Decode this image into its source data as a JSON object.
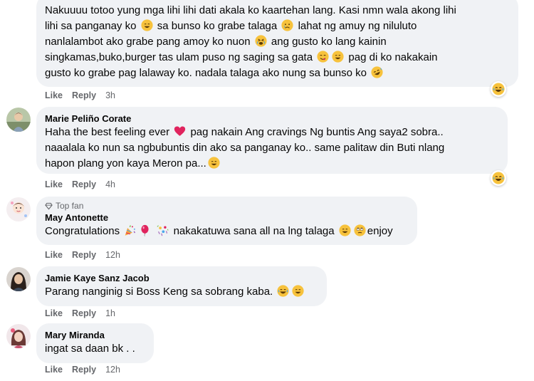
{
  "comments": [
    {
      "lines": [
        "Nakuuuu totoo yung mga lihi lihi dati akala ko kaartehan lang. Kasi nmn wala akong lihi",
        "lihi sa panganay ko",
        "sa bunso ko grabe talaga",
        "lahat ng amuy ng niluluto",
        "nanlalambot ako grabe pang amoy ko nuon",
        "ang gusto ko lang kainin",
        "singkamas,buko,burger tas ulam puso ng saging sa gata",
        "pag di ko nakakain",
        "gusto ko grabe pag lalaway ko. nadala talaga ako nung sa bunso ko"
      ],
      "like": "Like",
      "reply": "Reply",
      "time": "3h",
      "reaction": "haha"
    },
    {
      "author": "Marie Peliño Corate",
      "lines": [
        "Haha the best feeling ever",
        "pag nakain Ang cravings Ng buntis Ang saya2 sobra..",
        "naaalala ko nun sa ngbubuntis din ako sa panganay ko.. same palitaw din Buti nlang",
        "hapon plang yon kaya Meron pa..."
      ],
      "like": "Like",
      "reply": "Reply",
      "time": "4h",
      "reaction": "haha"
    },
    {
      "badge": "Top fan",
      "author": "May Antonette",
      "lines": [
        "Congratulations",
        "nakakatuwa sana all na lng talaga",
        "enjoy"
      ],
      "like": "Like",
      "reply": "Reply",
      "time": "12h"
    },
    {
      "author": "Jamie Kaye Sanz Jacob",
      "lines": [
        "Parang nanginig si Boss Keng sa sobrang kaba."
      ],
      "like": "Like",
      "reply": "Reply",
      "time": "1h"
    },
    {
      "author": "Mary Miranda",
      "lines": [
        "ingat sa daan bk . ."
      ],
      "like": "Like",
      "reply": "Reply",
      "time": "12h"
    }
  ],
  "colors": {
    "bubble": "#f0f2f5",
    "meta_text": "#65676b",
    "primary_text": "#050505",
    "emoji_yellow": "#f7c23c",
    "heart_red": "#e0245e"
  }
}
